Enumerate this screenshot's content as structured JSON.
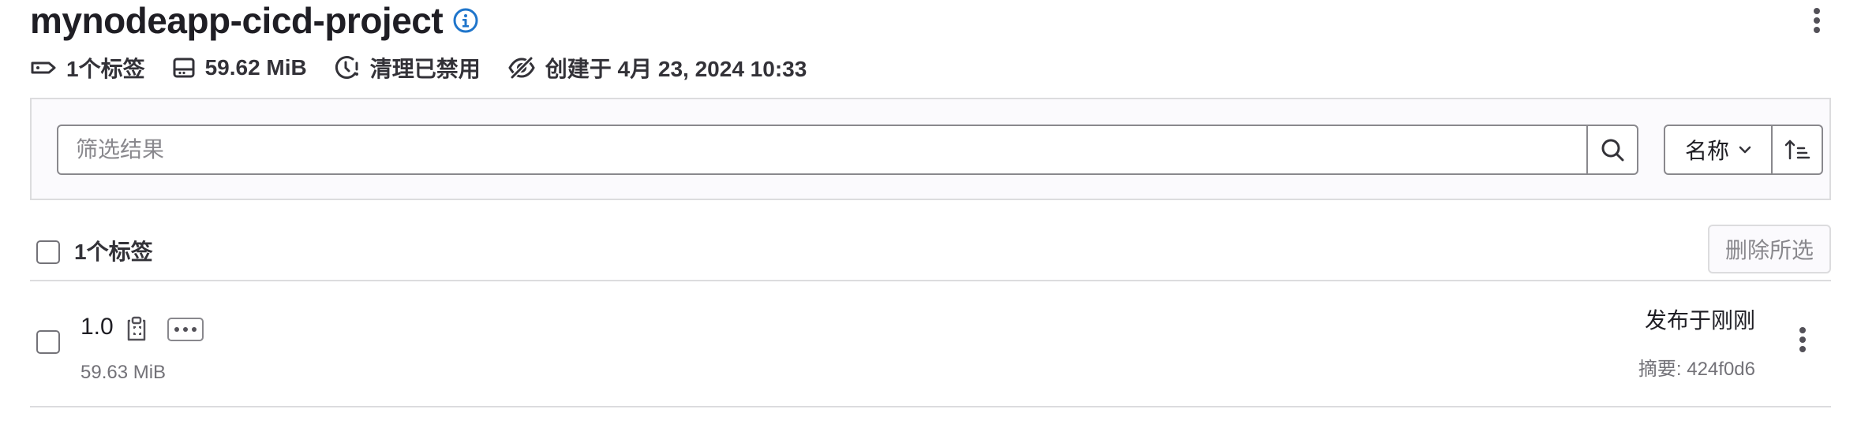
{
  "header": {
    "title": "mynodeapp-cicd-project",
    "meta": {
      "tags": "1个标签",
      "size": "59.62 MiB",
      "cleanup": "清理已禁用",
      "created": "创建于 4月 23, 2024 10:33"
    }
  },
  "filter": {
    "placeholder": "筛选结果",
    "sort_label": "名称"
  },
  "list": {
    "count_label": "1个标签",
    "delete_label": "删除所选",
    "rows": [
      {
        "name": "1.0",
        "size": "59.63 MiB",
        "published": "发布于刚刚",
        "digest": "摘要: 424f0d6"
      }
    ]
  },
  "icons": {
    "info": "info-circle-icon",
    "tag": "tag-icon",
    "storage": "disk-icon",
    "cleanup": "clock-schedule-icon",
    "visibility": "eye-slash-icon",
    "search": "search-icon",
    "sort_direction": "sort-lowest-icon",
    "copy": "copy-to-clipboard-icon",
    "more": "ellipsis-icon",
    "actions": "kebab-vertical-icon"
  },
  "colors": {
    "info_icon": "#1f75cb",
    "text": "#333238",
    "border": "#dcdcde"
  }
}
